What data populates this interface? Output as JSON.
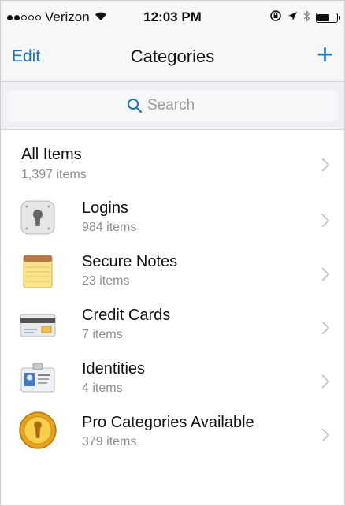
{
  "status_bar": {
    "carrier": "Verizon",
    "time": "12:03 PM",
    "signal_bars_filled": 2,
    "signal_bars_total": 5,
    "battery_level": 0.7
  },
  "nav": {
    "edit_label": "Edit",
    "title": "Categories",
    "add_label": "+"
  },
  "search": {
    "placeholder": "Search"
  },
  "all_items": {
    "title": "All Items",
    "count": "1,397 items"
  },
  "categories": [
    {
      "title": "Logins",
      "count": "984 items",
      "icon": "keyhole-icon"
    },
    {
      "title": "Secure Notes",
      "count": "23 items",
      "icon": "notepad-icon"
    },
    {
      "title": "Credit Cards",
      "count": "7 items",
      "icon": "credit-card-icon"
    },
    {
      "title": "Identities",
      "count": "4 items",
      "icon": "id-card-icon"
    },
    {
      "title": "Pro Categories Available",
      "count": "379 items",
      "icon": "gold-badge-icon"
    }
  ],
  "colors": {
    "accent": "#1a78c2",
    "secondary_text": "#8e8e8e",
    "bar_background": "#f7f7f7",
    "search_background": "#efeff4"
  }
}
